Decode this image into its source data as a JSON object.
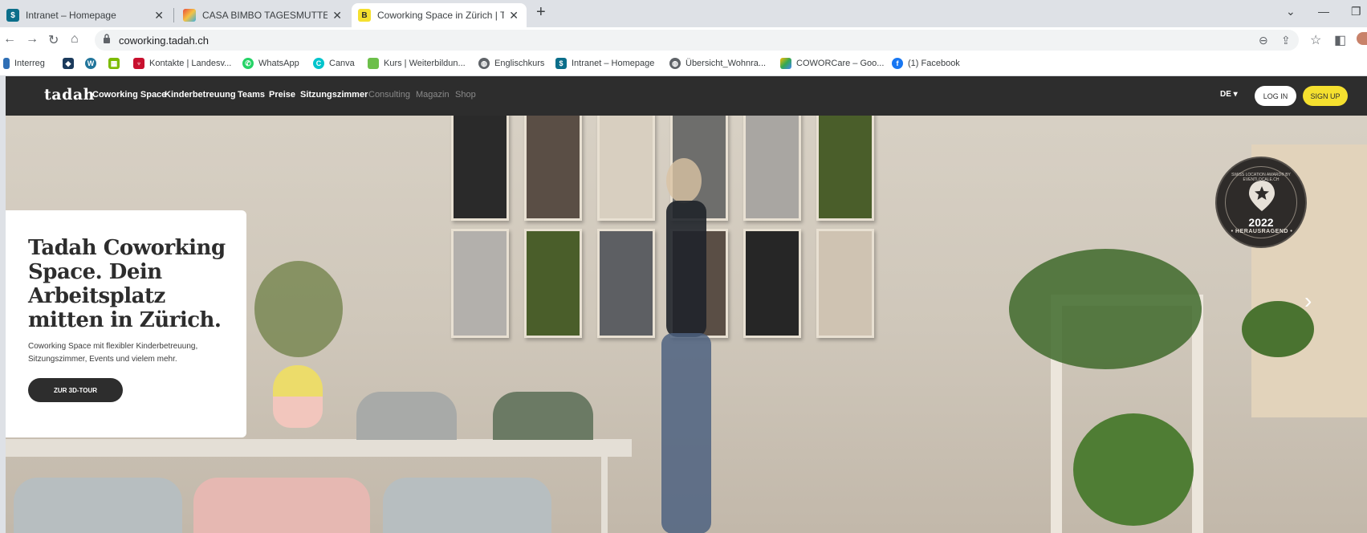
{
  "browser": {
    "tabs": [
      {
        "title": "Intranet – Homepage",
        "active": false
      },
      {
        "title": "CASA BIMBO TAGESMUTTER",
        "active": false
      },
      {
        "title": "Coworking Space in Zürich | Tada",
        "active": true
      }
    ],
    "new_tab": "+",
    "address": "coworking.tadah.ch",
    "bookmarks": [
      "Interreg",
      "",
      "",
      "",
      "Kontakte | Landesv...",
      "WhatsApp",
      "Canva",
      "Kurs | Weiterbildun...",
      "Englischkurs",
      "Intranet – Homepage",
      "Übersicht_Wohnra...",
      "COWORCare – Goo...",
      "(1) Facebook"
    ]
  },
  "site": {
    "logo": "tadah",
    "nav": [
      "Coworking Space",
      "Kinderbetreuung",
      "Teams",
      "Preise",
      "Sitzungszimmer",
      "Consulting",
      "Magazin",
      "Shop"
    ],
    "lang": "DE ▾",
    "login": "LOG IN",
    "signup": "SIGN UP",
    "hero": {
      "headline": "Tadah Coworking Space. Dein Arbeitsplatz mitten in Zürich.",
      "subtext": "Coworking Space mit flexibler Kinderbetreuung, Sitzungszimmer, Events und vielem mehr.",
      "cta": "ZUR 3D-TOUR"
    },
    "badge": {
      "ring_text": "SWISS LOCATION AWARD® BY EVENTLOCALE.CH",
      "year": "2022",
      "ribbon": "• HERAUSRAGEND •"
    },
    "slider_next": "›"
  },
  "colors": {
    "nav_bg": "#2d2d2d",
    "signup": "#f5e02f",
    "panel_green": "#4a5e2a"
  }
}
